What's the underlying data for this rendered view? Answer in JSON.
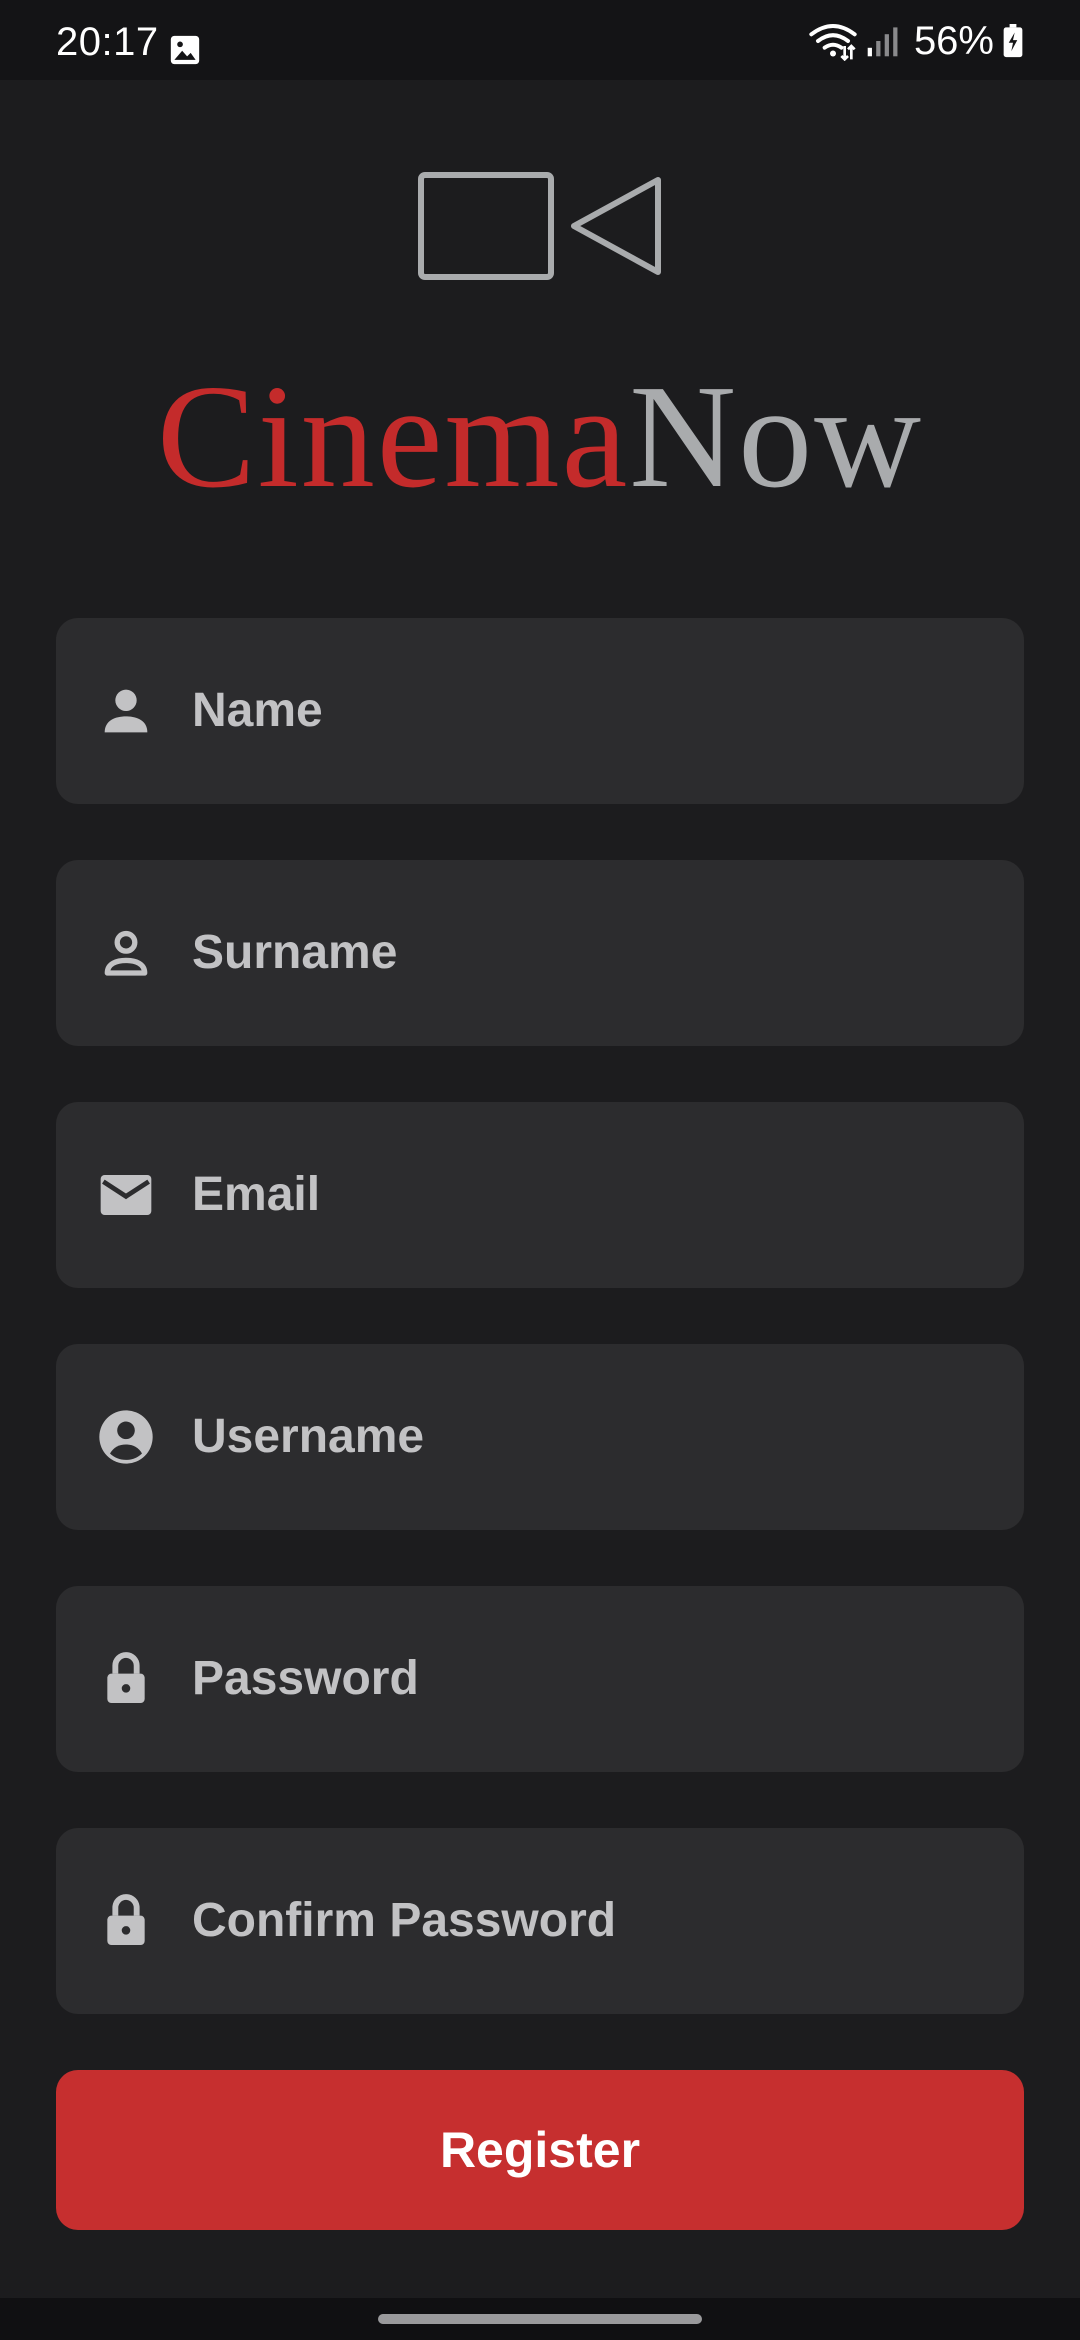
{
  "status_bar": {
    "time": "20:17",
    "battery_percent": "56%",
    "icons": [
      "gallery-icon",
      "wifi-icon",
      "signal-icon",
      "battery-icon"
    ]
  },
  "logo": {
    "icon": "video-camera-icon",
    "word_part1": "Cinema",
    "word_part2": "Now",
    "colors": {
      "cinema": "#c42b2b",
      "now": "#a9abad",
      "camera_outline": "#a9abad"
    }
  },
  "form": {
    "fields": [
      {
        "placeholder": "Name",
        "icon": "person-icon",
        "value": ""
      },
      {
        "placeholder": "Surname",
        "icon": "person-outline-icon",
        "value": ""
      },
      {
        "placeholder": "Email",
        "icon": "mail-icon",
        "value": ""
      },
      {
        "placeholder": "Username",
        "icon": "account-circle-icon",
        "value": ""
      },
      {
        "placeholder": "Password",
        "icon": "lock-icon",
        "value": ""
      },
      {
        "placeholder": "Confirm Password",
        "icon": "lock-icon",
        "value": ""
      }
    ],
    "register_label": "Register"
  },
  "colors": {
    "background": "#1c1c1e",
    "field_background": "#2c2c2e",
    "accent": "#c62f2f",
    "placeholder_text": "#c2c2c4"
  }
}
